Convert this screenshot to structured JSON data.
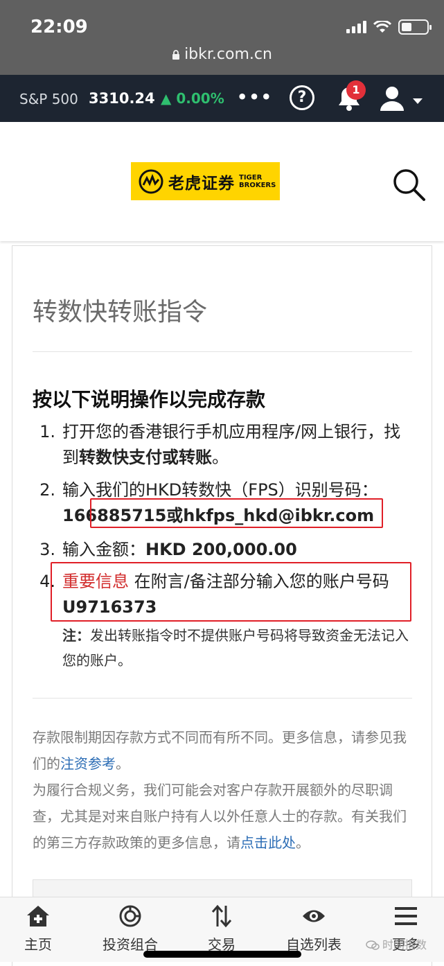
{
  "status_bar": {
    "time": "22:09",
    "url": "ibkr.com.cn"
  },
  "ticker": {
    "name": "S&P 500",
    "price": "3310.24",
    "change": "0.00%",
    "more": "•••",
    "help": "?",
    "notification_count": "1"
  },
  "brand": {
    "logo_cn": "老虎证券",
    "logo_en_line1": "TIGER",
    "logo_en_line2": "BROKERS"
  },
  "page": {
    "title": "转数快转账指令",
    "instructions_heading": "按以下说明操作以完成存款",
    "steps": [
      {
        "num": "1.",
        "text_before": "打开您的香港银行手机应用程序/网上银行，找到",
        "bold": "转数快支付或转账",
        "text_after": "。"
      },
      {
        "num": "2.",
        "text_before": "输入我们的HKD转数快（FPS）识别号码：",
        "bold": "166885715或hkfps_hkd@ibkr.com"
      },
      {
        "num": "3.",
        "text_before": "输入金额：",
        "bold": "HKD 200,000.00"
      },
      {
        "num": "4.",
        "red": "重要信息",
        "text_before": "在附言/备注部分输入您的账户号码",
        "bold": "U9716373"
      }
    ],
    "note_label": "注：",
    "note_text": "发出转账指令时不提供账户号码将导致资金无法记入您的账户。",
    "para1_text": "存款限制期因存款方式不同而有所不同。更多信息，请参见我们的",
    "para1_link": "注资参考",
    "para1_end": "。",
    "para2_text": "为履行合规义务，我们可能会对客户存款开展额外的尽职调查，尤其是对来自账户持有人以外任意人士的存款。有关我们的第三方存款政策的更多信息，请",
    "para2_link": "点击此处",
    "para2_end": "。"
  },
  "bottom_nav": [
    {
      "label": "主页",
      "icon": "home-icon"
    },
    {
      "label": "投资组合",
      "icon": "portfolio-icon"
    },
    {
      "label": "交易",
      "icon": "trade-icon"
    },
    {
      "label": "自选列表",
      "icon": "watchlist-icon"
    },
    {
      "label": "更多",
      "icon": "menu-icon"
    }
  ],
  "watermark": "时间指数",
  "colors": {
    "ticker_bg": "#1d2531",
    "positive": "#2fbf6f",
    "brand_yellow": "#ffd400",
    "highlight_red": "#e01f27",
    "link": "#2c6db5"
  }
}
